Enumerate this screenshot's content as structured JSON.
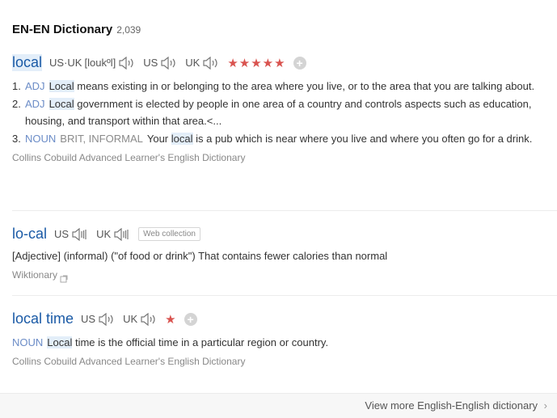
{
  "header": {
    "title": "EN-EN Dictionary",
    "count": "2,039"
  },
  "entries": [
    {
      "word": "local",
      "pron": [
        {
          "label": "US·UK",
          "ipa": "[loukºl]"
        },
        {
          "label": "US"
        },
        {
          "label": "UK"
        }
      ],
      "stars": "★★★★★",
      "senses": [
        {
          "num": "1.",
          "pos": "ADJ",
          "hl": "Local",
          "text": " means existing in or belonging to the area where you live, or to the area that you are talking about."
        },
        {
          "num": "2.",
          "pos": "ADJ",
          "hl": "Local",
          "text": " government is elected by people in one area of a country and controls aspects such as education, housing, and transport within that area.<..."
        },
        {
          "num": "3.",
          "pos": "NOUN",
          "reg": "BRIT, INFORMAL",
          "pre": "Your ",
          "hl": "local",
          "text": " is a pub which is near where you live and where you often go for a drink."
        }
      ],
      "source": "Collins Cobuild Advanced Learner's English Dictionary"
    },
    {
      "word": "lo-cal",
      "pron": [
        {
          "label": "US"
        },
        {
          "label": "UK"
        }
      ],
      "tag": "Web collection",
      "text": "[Adjective] (informal) (\"of food or drink\") That contains fewer calories than normal",
      "source": "Wiktionary"
    },
    {
      "word": "local time",
      "pron": [
        {
          "label": "US"
        },
        {
          "label": "UK"
        }
      ],
      "stars": "★",
      "pos": "NOUN",
      "hl": "Local",
      "text": " time is the official time in a particular region or country.",
      "source": "Collins Cobuild Advanced Learner's English Dictionary"
    }
  ],
  "footer": {
    "more": "View more English-English dictionary"
  },
  "icons": {
    "speaker": "speaker-icon",
    "add": "plus-icon",
    "chevron": "chevron-right-icon",
    "external": "external-link-icon"
  },
  "colors": {
    "word": "#1a5aa6",
    "star": "#d9534f",
    "pos": "#6b8cc7",
    "highlight": "#e3eef9"
  }
}
